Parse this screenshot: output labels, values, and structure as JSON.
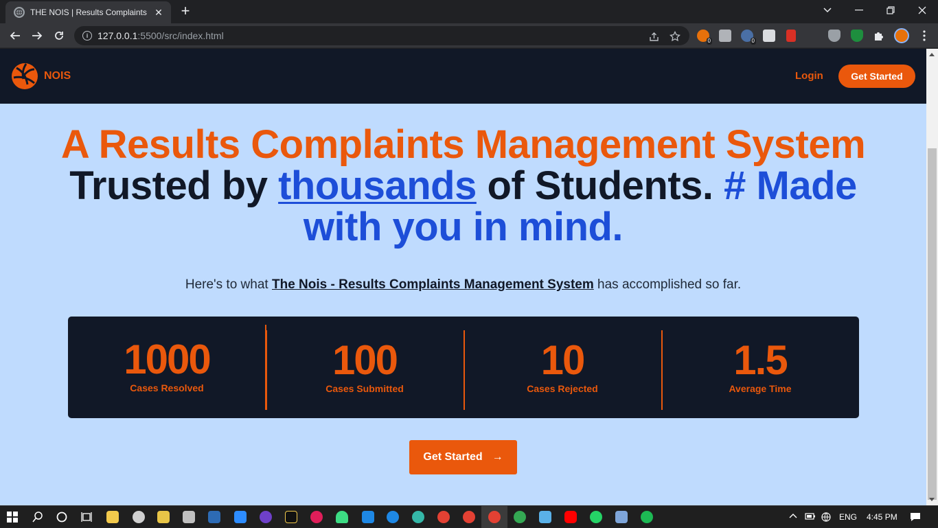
{
  "browser": {
    "tab_title": "THE NOIS | Results Complaints Management System",
    "tab_close": "✕",
    "new_tab": "+",
    "url_host": "127.0.0.1",
    "url_path": ":5500/src/index.html",
    "ext_badge_a": "0",
    "ext_badge_b": "0"
  },
  "nav": {
    "logo_text": "NOIS",
    "login": "Login",
    "cta": "Get Started"
  },
  "hero": {
    "line1": "A Results Complaints Management System",
    "line2_a": "Trusted by ",
    "line2_b": "thousands",
    "line2_c": " of Students. ",
    "line2_d": "# Made with you in mind."
  },
  "sub": {
    "prefix": "Here's to what ",
    "link": "The Nois - Results Complaints Management System",
    "suffix": " has accomplished so far."
  },
  "stats": [
    {
      "value": "1000",
      "label": "Cases Resolved"
    },
    {
      "value": "100",
      "label": "Cases Submitted"
    },
    {
      "value": "10",
      "label": "Cases Rejected"
    },
    {
      "value": "1.5",
      "label": "Average Time"
    }
  ],
  "cta": {
    "label": "Get Started",
    "arrow": "→"
  },
  "taskbar": {
    "language": "ENG",
    "time": "4:45 PM"
  },
  "colors": {
    "accent": "#ea580c",
    "navy": "#111827",
    "blue": "#1d4ed8",
    "page_bg": "#bfdbfe"
  }
}
